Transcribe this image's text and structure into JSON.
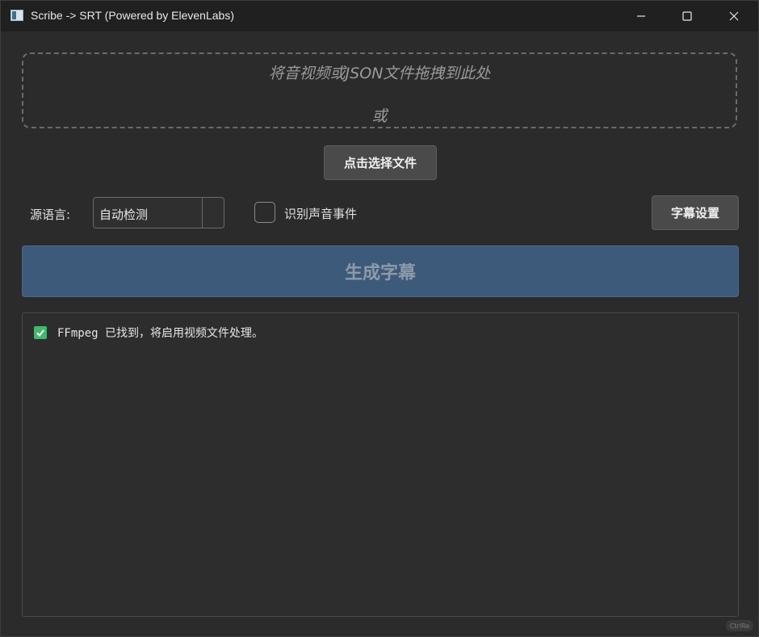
{
  "window": {
    "title": "Scribe -> SRT (Powered by ElevenLabs)"
  },
  "dropzone": {
    "prompt": "将音视频或JSON文件拖拽到此处",
    "or_text": "或"
  },
  "select_file_button": "点击选择文件",
  "language": {
    "label": "源语言:",
    "selected": "自动检测"
  },
  "sound_events": {
    "label": "识别声音事件",
    "checked": false
  },
  "subtitle_settings_button": "字幕设置",
  "generate_button": "生成字幕",
  "log": {
    "entries": [
      {
        "icon": "check-icon",
        "text": "FFmpeg 已找到，将启用视频文件处理。"
      }
    ]
  },
  "corner_badge": "CtrlRe",
  "colors": {
    "accent_button": "#3d5a7b",
    "success": "#3fb96a",
    "background": "#2b2b2b"
  }
}
